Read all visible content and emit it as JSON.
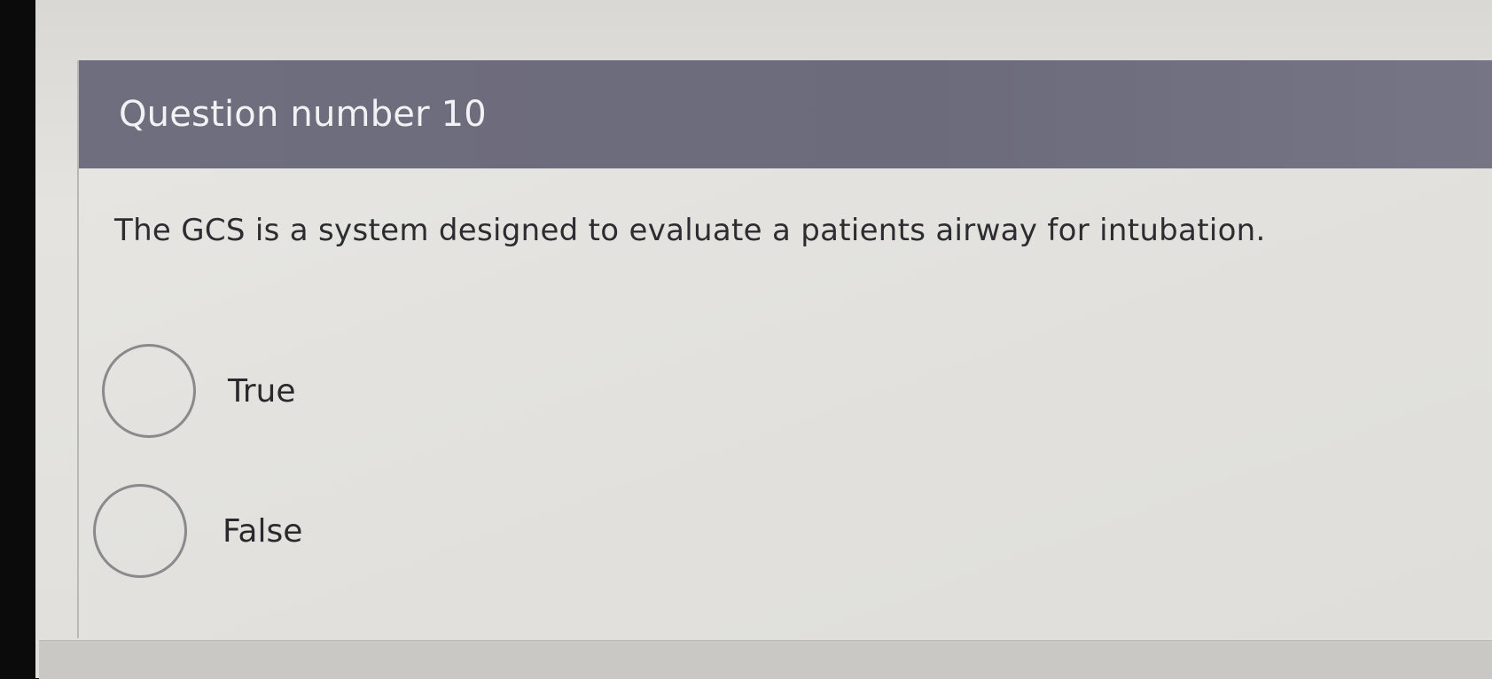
{
  "question": {
    "title": "Question number 10",
    "prompt": "The GCS is a system designed to evaluate a patients airway for intubation."
  },
  "options": [
    {
      "label": "True",
      "selected": false
    },
    {
      "label": "False",
      "selected": false
    }
  ],
  "colors": {
    "header_bg": "#6f6e7e",
    "header_text": "#f2f2f4",
    "card_bg": "#e4e3df",
    "body_text": "#2d2d31",
    "radio_border": "#8a8a8c"
  }
}
